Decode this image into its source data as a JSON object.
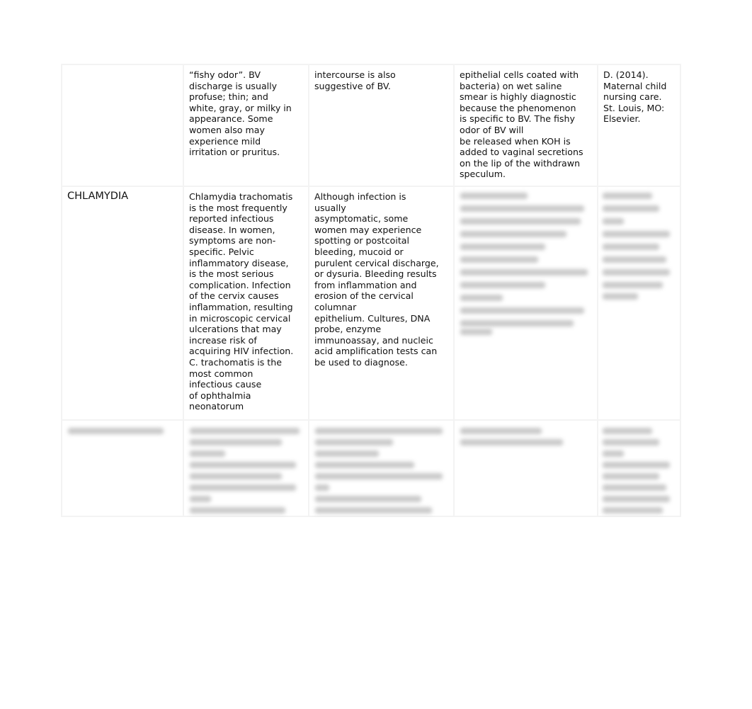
{
  "table": {
    "rows": [
      {
        "condition": "",
        "col2": "“fishy odor”. BV\ndischarge is usually\nprofuse; thin; and\nwhite, gray, or milky in\nappearance. Some\nwomen also may\nexperience mild\nirritation or pruritus.",
        "col3": "intercourse is also\nsuggestive of BV.",
        "col4": "epithelial cells coated with\nbacteria) on wet saline\nsmear is highly diagnostic\nbecause the phenomenon\nis specific to BV. The fishy\nodor of BV will\nbe released when KOH is\nadded to vaginal secretions\non the lip of the withdrawn\nspeculum.",
        "col5": "D. (2014).\nMaternal child\nnursing care.\nSt. Louis, MO:\nElsevier."
      },
      {
        "condition": "CHLAMYDIA",
        "col2": "Chlamydia trachomatis\nis the most frequently\nreported infectious\ndisease. In women,\nsymptoms are non-\nspecific. Pelvic\ninflammatory disease,\nis the most serious\ncomplication. Infection\nof the cervix causes\ninflammation, resulting\nin microscopic cervical\nulcerations that may\nincrease risk of\nacquiring HIV infection.\nC. trachomatis is the\nmost common\ninfectious cause\nof ophthalmia\nneonatorum",
        "col3": "Although infection is\nusually\nasymptomatic, some\nwomen may experience\nspotting or postcoital\nbleeding, mucoid or\npurulent cervical discharge,\nor dysuria. Bleeding results\nfrom inflammation and\nerosion of the cervical\ncolumnar\nepithelium. Cultures, DNA\nprobe, enzyme\nimmunoassay, and nucleic\nacid amplification tests can\nbe used to diagnose."
      }
    ]
  }
}
